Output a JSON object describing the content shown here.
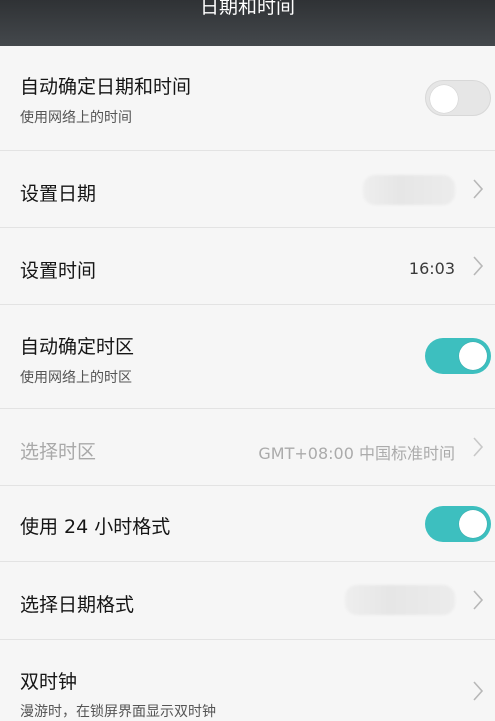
{
  "header": {
    "title": "日期和时间"
  },
  "settings": {
    "auto_datetime": {
      "title": "自动确定日期和时间",
      "subtitle": "使用网络上的时间",
      "enabled": false
    },
    "set_date": {
      "title": "设置日期"
    },
    "set_time": {
      "title": "设置时间",
      "value": "16:03"
    },
    "auto_timezone": {
      "title": "自动确定时区",
      "subtitle": "使用网络上的时区",
      "enabled": true
    },
    "select_timezone": {
      "title": "选择时区",
      "value": "GMT+08:00 中国标准时间"
    },
    "use_24h": {
      "title": "使用 24 小时格式",
      "enabled": true
    },
    "date_format": {
      "title": "选择日期格式"
    },
    "dual_clock": {
      "title": "双时钟",
      "subtitle": "漫游时，在锁屏界面显示双时钟"
    }
  },
  "icons": {
    "chevron": "chevron-right-icon"
  },
  "colors": {
    "accent": "#3dbfbf",
    "header_bg": "#3a3d40",
    "background": "#f6f6f6"
  }
}
